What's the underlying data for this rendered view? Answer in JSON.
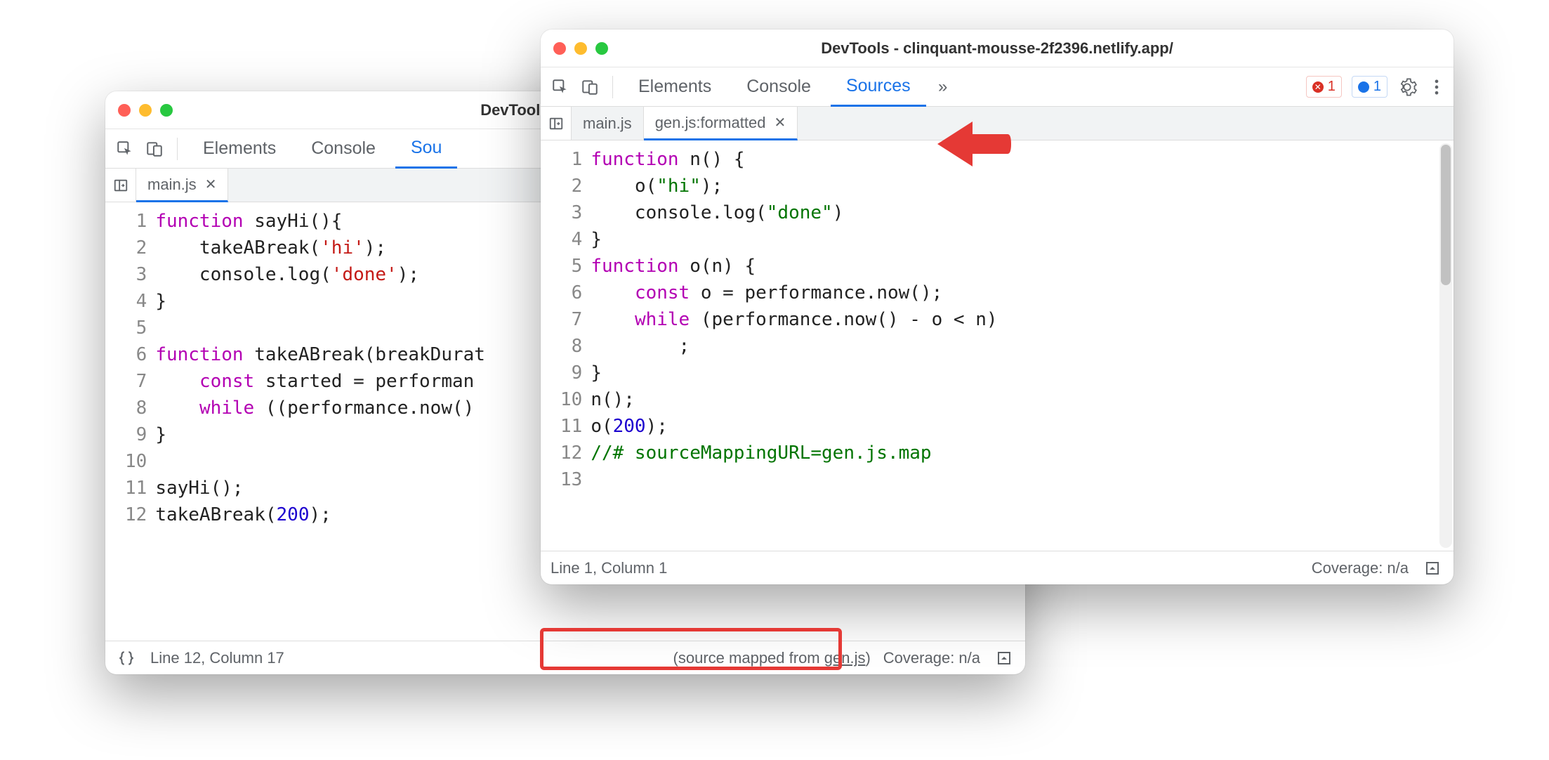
{
  "window_back": {
    "title": "DevTools - clinquant-m",
    "toolbar_tabs": [
      "Elements",
      "Console",
      "Sou"
    ],
    "active_tab": 2,
    "file_tabs": [
      {
        "label": "main.js",
        "active": true
      }
    ],
    "code_lines": [
      {
        "n": 1,
        "html": "<span class='kw'>function</span> <span class='fn'>sayHi</span>(){"
      },
      {
        "n": 2,
        "html": "    <span class='fn'>takeABreak</span>(<span class='str'>'hi'</span>);"
      },
      {
        "n": 3,
        "html": "    console.<span class='fn'>log</span>(<span class='str'>'done'</span>);"
      },
      {
        "n": 4,
        "html": "}"
      },
      {
        "n": 5,
        "html": ""
      },
      {
        "n": 6,
        "html": "<span class='kw'>function</span> <span class='fn'>takeABreak</span>(breakDurat"
      },
      {
        "n": 7,
        "html": "    <span class='const'>const</span> started = performan"
      },
      {
        "n": 8,
        "html": "    <span class='kw'>while</span> ((performance.<span class='fn'>now</span>()"
      },
      {
        "n": 9,
        "html": "}"
      },
      {
        "n": 10,
        "html": ""
      },
      {
        "n": 11,
        "html": "<span class='fn'>sayHi</span>();"
      },
      {
        "n": 12,
        "html": "<span class='fn'>takeABreak</span>(<span class='num'>200</span>);"
      }
    ],
    "status": {
      "line_col": "Line 12, Column 17",
      "mapped_prefix": "(source mapped from ",
      "mapped_link": "gen.js",
      "mapped_suffix": ")",
      "coverage": "Coverage: n/a"
    }
  },
  "window_front": {
    "title": "DevTools - clinquant-mousse-2f2396.netlify.app/",
    "toolbar_tabs": [
      "Elements",
      "Console",
      "Sources"
    ],
    "active_tab": 2,
    "badges": {
      "errors": "1",
      "messages": "1"
    },
    "file_tabs": [
      {
        "label": "main.js",
        "active": false
      },
      {
        "label": "gen.js:formatted",
        "active": true
      }
    ],
    "code_lines": [
      {
        "n": 1,
        "html": "<span class='kw'>function</span> <span class='fn'>n</span>() {"
      },
      {
        "n": 2,
        "html": "    <span class='fn'>o</span>(<span class='strg'>\"hi\"</span>);"
      },
      {
        "n": 3,
        "html": "    console.<span class='fn'>log</span>(<span class='strg'>\"done\"</span>)"
      },
      {
        "n": 4,
        "html": "}"
      },
      {
        "n": 5,
        "html": "<span class='kw'>function</span> <span class='fn'>o</span>(n) {"
      },
      {
        "n": 6,
        "html": "    <span class='const'>const</span> o = performance.<span class='fn'>now</span>();"
      },
      {
        "n": 7,
        "html": "    <span class='kw'>while</span> (performance.<span class='fn'>now</span>() - o &lt; n)"
      },
      {
        "n": 8,
        "html": "        ;"
      },
      {
        "n": 9,
        "html": "}"
      },
      {
        "n": 10,
        "html": "<span class='fn'>n</span>();"
      },
      {
        "n": 11,
        "html": "<span class='fn'>o</span>(<span class='num'>200</span>);"
      },
      {
        "n": 12,
        "html": "<span class='comment'>//# sourceMappingURL=gen.js.map</span>"
      },
      {
        "n": 13,
        "html": ""
      }
    ],
    "status": {
      "line_col": "Line 1, Column 1",
      "coverage": "Coverage: n/a"
    }
  }
}
